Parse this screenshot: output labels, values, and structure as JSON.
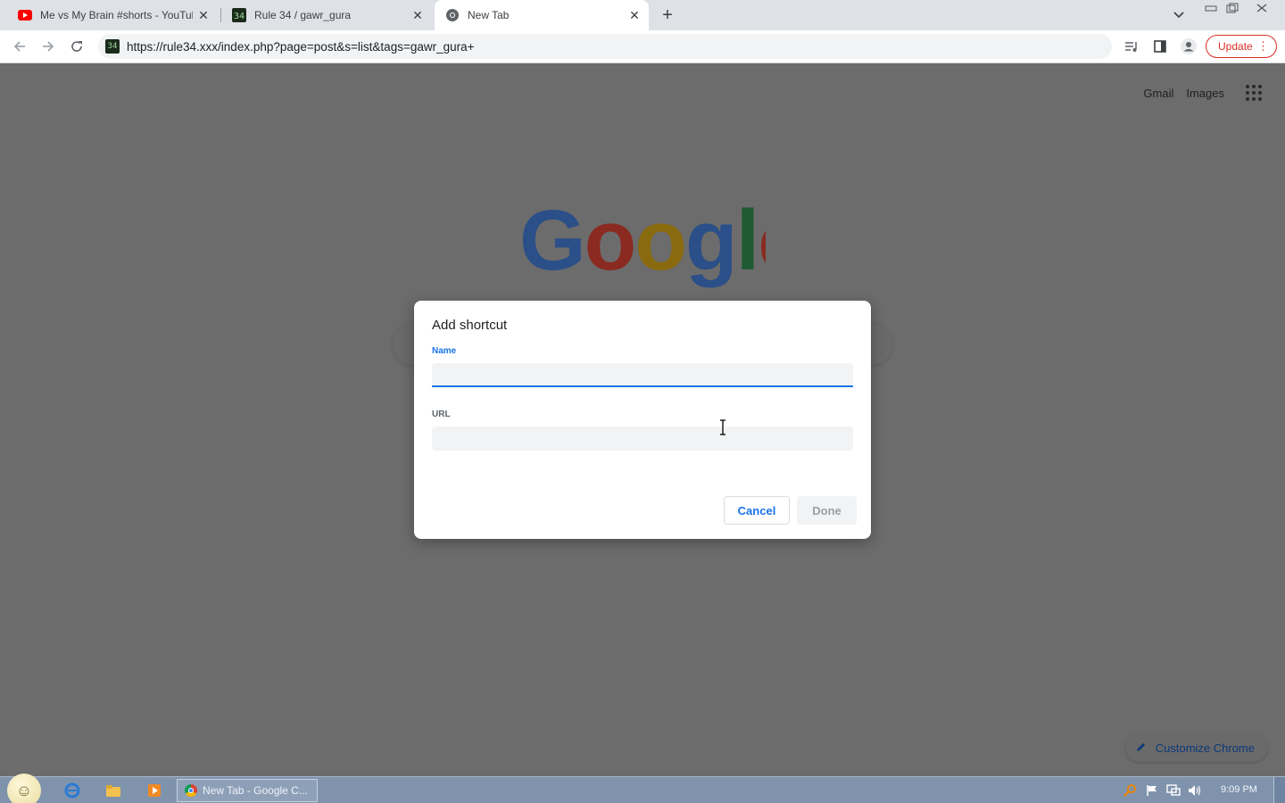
{
  "browser": {
    "tabs": [
      {
        "title": "Me vs My Brain #shorts - YouTub",
        "icon": "youtube-icon",
        "active": false
      },
      {
        "title": "Rule 34 / gawr_gura",
        "icon": "rule34-site-icon",
        "active": false
      },
      {
        "title": "New Tab",
        "icon": "chrome-new-tab-icon",
        "active": true
      }
    ],
    "url": "https://rule34.xxx/index.php?page=post&s=list&tags=gawr_gura+",
    "update_label": "Update"
  },
  "newtab": {
    "gmail": "Gmail",
    "images": "Images",
    "logo_text": "Google",
    "customize": "Customize Chrome"
  },
  "dialog": {
    "title": "Add shortcut",
    "name_label": "Name",
    "name_value": "",
    "url_label": "URL",
    "url_value": "",
    "cancel": "Cancel",
    "done": "Done"
  },
  "taskbar": {
    "task_label": "New Tab - Google C...",
    "clock": "9:09 PM"
  },
  "colors": {
    "accent": "#1a73e8",
    "update_red": "#d93025",
    "overlay": "#6c6c6c"
  }
}
